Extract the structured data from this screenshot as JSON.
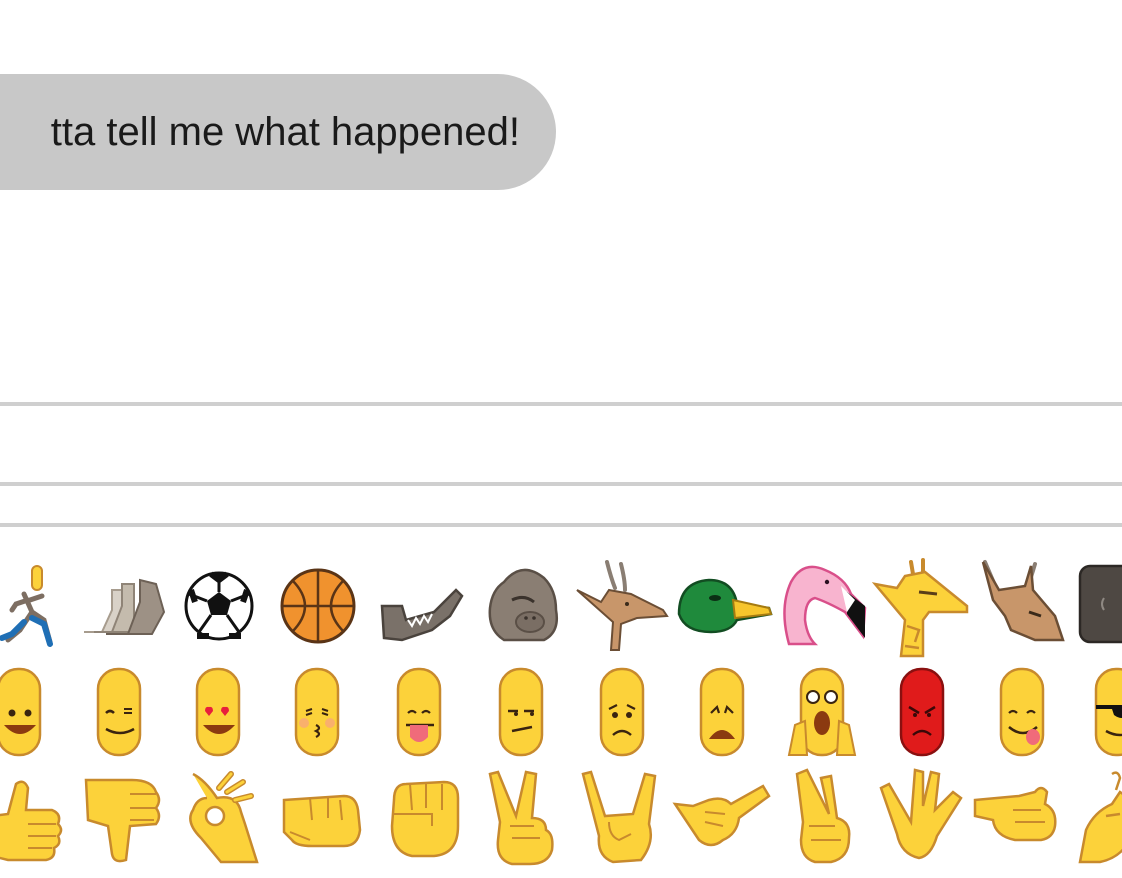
{
  "conversation": {
    "message": "tta tell me what happened!"
  },
  "emoji_tray": {
    "rows": [
      {
        "category": "activity-and-animals",
        "items": [
          "running-person",
          "stacked-feet",
          "soccer-ball",
          "basketball",
          "crocodile",
          "gorilla",
          "antelope",
          "duck",
          "flamingo",
          "giraffe",
          "goat",
          "dark-tile"
        ]
      },
      {
        "category": "faces",
        "items": [
          "smiling-face",
          "winking-face",
          "heart-eyes-face",
          "kissing-face",
          "tongue-out-face",
          "unamused-face",
          "worried-face",
          "sad-face",
          "screaming-face",
          "angry-face",
          "yum-face",
          "sunglasses-face"
        ]
      },
      {
        "category": "hands",
        "items": [
          "thumbs-up",
          "thumbs-down",
          "ok-hand",
          "fist-bump",
          "raised-fist",
          "victory-hand",
          "rock-on-hand",
          "call-me-hand",
          "crossed-fingers",
          "vulcan-salute",
          "pointing-right",
          "pinching-hand"
        ]
      }
    ]
  },
  "colors": {
    "bubble": "#c8c8c8",
    "rule": "#cfcfcf",
    "face_fill": "#fcd23a",
    "face_outline": "#c88a2d",
    "angry_fill": "#e01b1b"
  }
}
